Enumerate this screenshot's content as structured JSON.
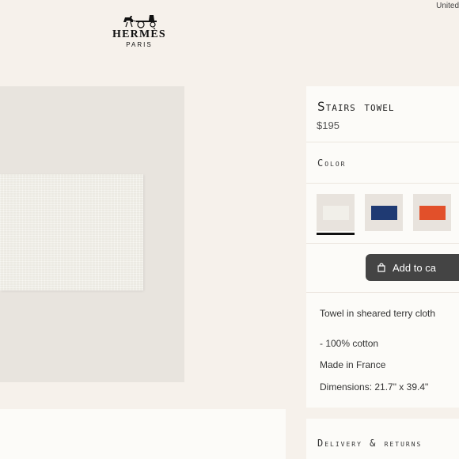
{
  "header": {
    "region_label": "United",
    "brand": {
      "name": "HERMÈS",
      "sub": "PARIS"
    }
  },
  "product": {
    "title": "Stairs towel",
    "price": "$195",
    "color_label": "Color",
    "swatches": [
      {
        "name": "white",
        "color": "#f1efe9",
        "selected": true
      },
      {
        "name": "blue",
        "color": "#1f3a73",
        "selected": false
      },
      {
        "name": "orange",
        "color": "#e2502a",
        "selected": false
      }
    ],
    "add_to_cart": "Add to ca",
    "description": [
      "Towel in sheared terry cloth",
      "- 100% cotton",
      "Made in France",
      "Dimensions: 21.7\" x 39.4\""
    ],
    "delivery_label": "Delivery & returns"
  },
  "colors": {
    "page_bg": "#f6f1eb",
    "card_bg": "#fcfbf8",
    "button_bg": "#444444"
  }
}
